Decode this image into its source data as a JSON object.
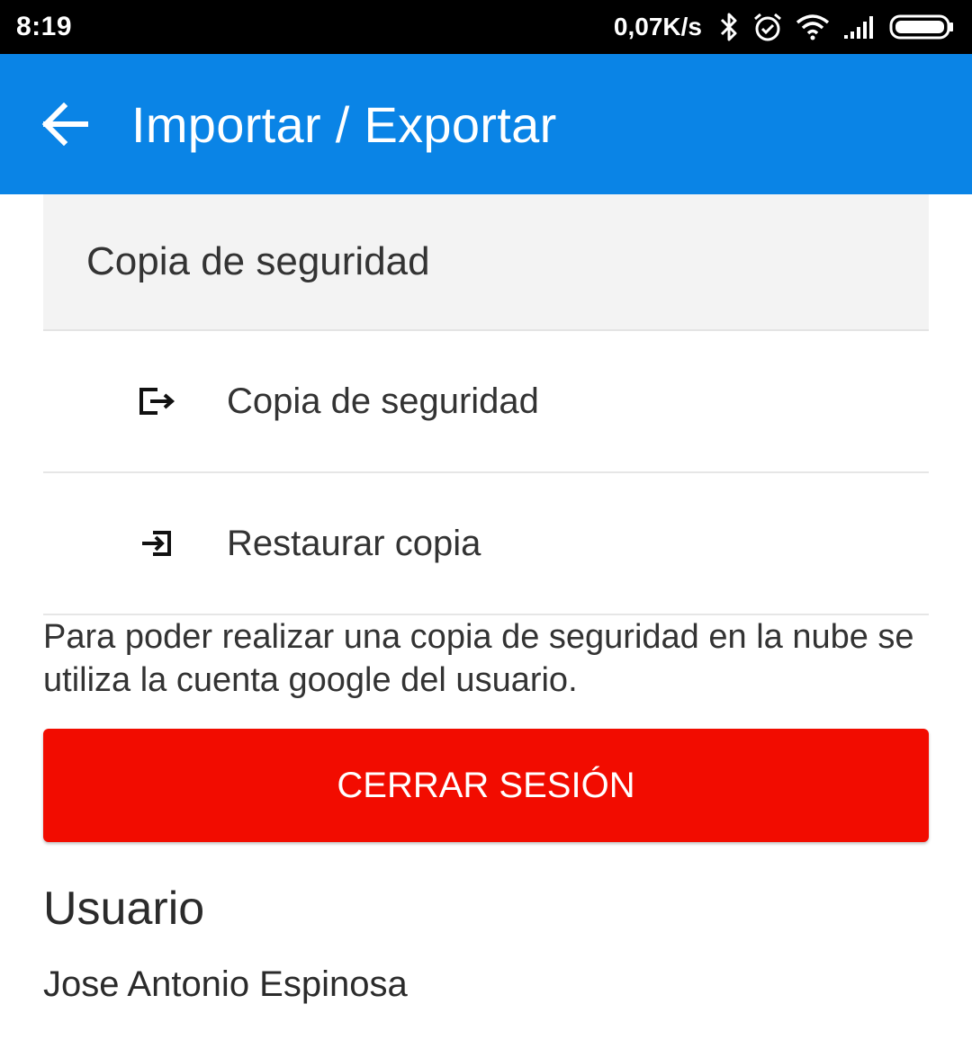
{
  "status_bar": {
    "time": "8:19",
    "net_speed": "0,07K/s",
    "icons": [
      "bluetooth-icon",
      "alarm-icon",
      "wifi-icon",
      "signal-icon",
      "battery-icon"
    ]
  },
  "app_bar": {
    "title": "Importar / Exportar",
    "color": "#0A84E6"
  },
  "section": {
    "header": "Copia de seguridad",
    "items": [
      {
        "label": "Copia de seguridad",
        "icon": "export-icon"
      },
      {
        "label": "Restaurar copia",
        "icon": "import-icon"
      }
    ]
  },
  "info": {
    "text": "Para poder realizar una copia de seguridad en la nube se utiliza la cuenta google del usuario."
  },
  "logout": {
    "label": "CERRAR SESIÓN",
    "color": "#F20C00"
  },
  "user": {
    "heading": "Usuario",
    "name": "Jose Antonio Espinosa"
  }
}
